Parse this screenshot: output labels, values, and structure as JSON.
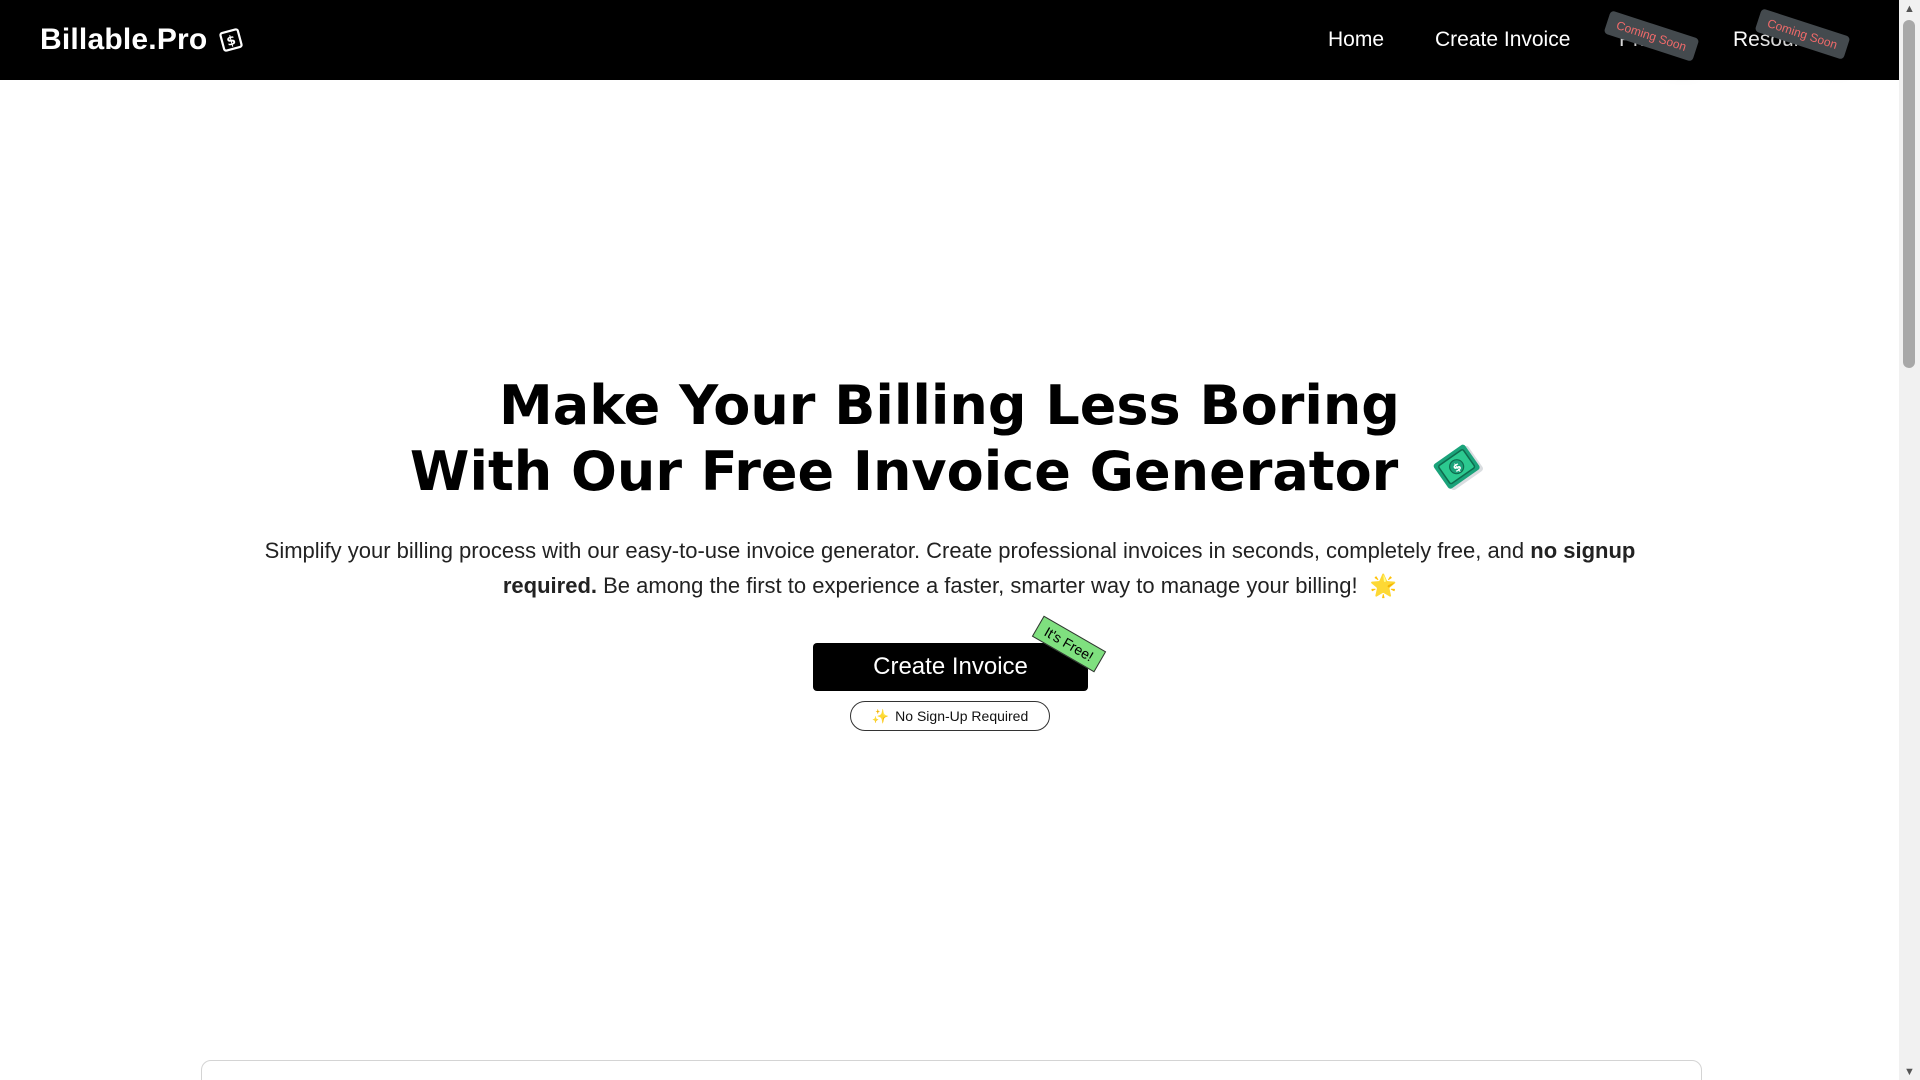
{
  "navbar": {
    "brand": "Billable.Pro",
    "links": {
      "home": "Home",
      "create_invoice": "Create Invoice",
      "pricing": "Pricing",
      "resources": "Resources"
    },
    "coming_soon": "Coming Soon"
  },
  "hero": {
    "title_line1": "Make Your Billing Less Boring",
    "title_line2": "With Our Free Invoice Generator",
    "subtitle_part1": "Simplify your billing process with our easy-to-use invoice generator. Create professional invoices in seconds, completely free, and ",
    "subtitle_bold": "no signup required.",
    "subtitle_part2": " Be among the first to experience a faster, smarter way to manage your billing!",
    "subtitle_emoji": "🌟",
    "cta_label": "Create Invoice",
    "cta_tag": "It's Free!",
    "pill_icon": "✨",
    "pill_label": "No Sign-Up Required"
  },
  "colors": {
    "navbar_bg": "#000000",
    "free_tag": "#7fe07f",
    "coming_soon_text": "#f06a6a"
  },
  "icons": [
    "dollar-box-icon",
    "money-bill-icon",
    "sparkle-icon",
    "sun-icon",
    "scroll-up-arrow-icon",
    "scroll-down-arrow-icon"
  ]
}
